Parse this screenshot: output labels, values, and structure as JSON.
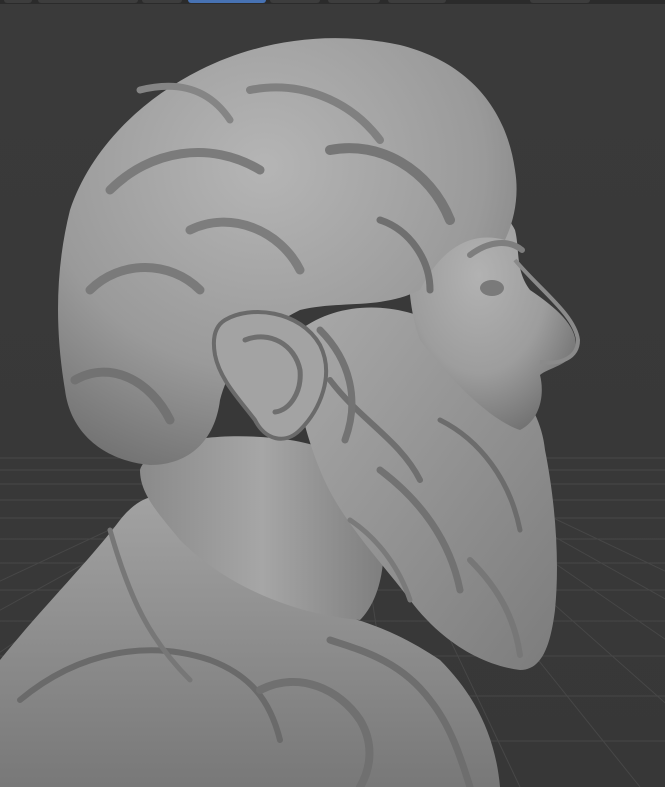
{
  "app": {
    "title": "",
    "mode": "sculpt",
    "shading": "solid"
  },
  "viewport": {
    "background_color": "#393939",
    "grid_color": "#4a4a4a",
    "grid_visible": true,
    "object_color": "#9c9c9c",
    "object_name": "bust-sculpture",
    "view": "perspective"
  },
  "header": {
    "buttons": [
      {
        "name": "header-button-1",
        "active": false
      },
      {
        "name": "header-button-2",
        "active": false
      },
      {
        "name": "header-button-3",
        "active": false
      },
      {
        "name": "header-button-active",
        "active": true
      },
      {
        "name": "header-button-4",
        "active": false
      },
      {
        "name": "header-button-5",
        "active": false
      },
      {
        "name": "header-button-6",
        "active": false
      },
      {
        "name": "header-button-7",
        "active": false
      }
    ],
    "accent_color": "#4772b3"
  }
}
